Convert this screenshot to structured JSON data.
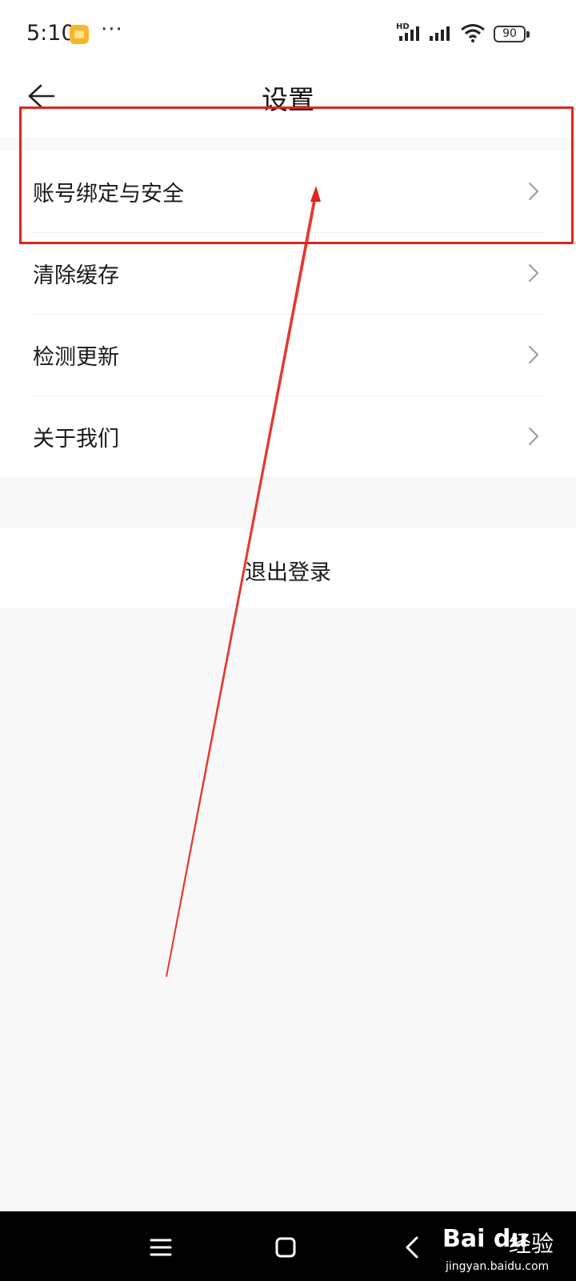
{
  "status_bar": {
    "time": "5:10",
    "more": "···",
    "network_type": "HD",
    "battery_level": "90",
    "icons": [
      "app-notification-icon",
      "signal-icon",
      "signal-icon",
      "wifi-icon",
      "battery-icon"
    ]
  },
  "header": {
    "title": "设置",
    "back_icon": "back-arrow-icon"
  },
  "settings": {
    "items": [
      {
        "label": "账号绑定与安全"
      },
      {
        "label": "清除缓存"
      },
      {
        "label": "检测更新"
      },
      {
        "label": "关于我们"
      }
    ]
  },
  "logout": {
    "label": "退出登录"
  },
  "annotation": {
    "color": "#e2231a"
  },
  "nav_bar": {
    "icons": [
      "menu-icon",
      "home-icon",
      "back-icon"
    ]
  },
  "watermark": {
    "logo": "Bai du",
    "text": "经验",
    "url": "jingyan.baidu.com"
  }
}
